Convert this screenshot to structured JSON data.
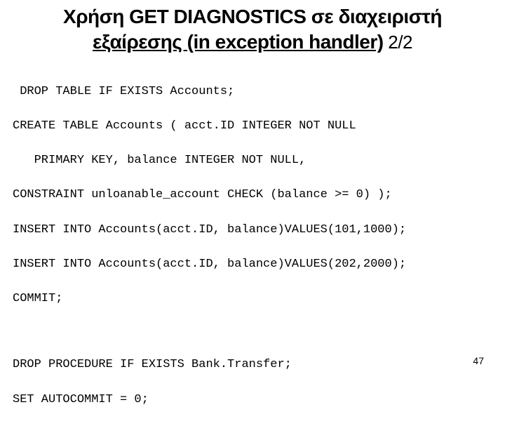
{
  "title": {
    "line1": "Χρήση GET DIAGNOSTICS σε διαχειριστή",
    "line2_underlined": "εξαίρεσης (in exception handler)",
    "line2_suffix": " 2/2"
  },
  "code": {
    "block1": [
      " DROP TABLE IF EXISTS Accounts;",
      "CREATE TABLE Accounts ( acct.ID INTEGER NOT NULL",
      "   PRIMARY KEY, balance INTEGER NOT NULL,",
      "CONSTRAINT unloanable_account CHECK (balance >= 0) );",
      "INSERT INTO Accounts(acct.ID, balance)VALUES(101,1000);",
      "INSERT INTO Accounts(acct.ID, balance)VALUES(202,2000);",
      "COMMIT;"
    ],
    "block2": [
      "DROP PROCEDURE IF EXISTS Bank.Transfer;",
      "SET AUTOCOMMIT = 0;"
    ]
  },
  "page_number": "47"
}
